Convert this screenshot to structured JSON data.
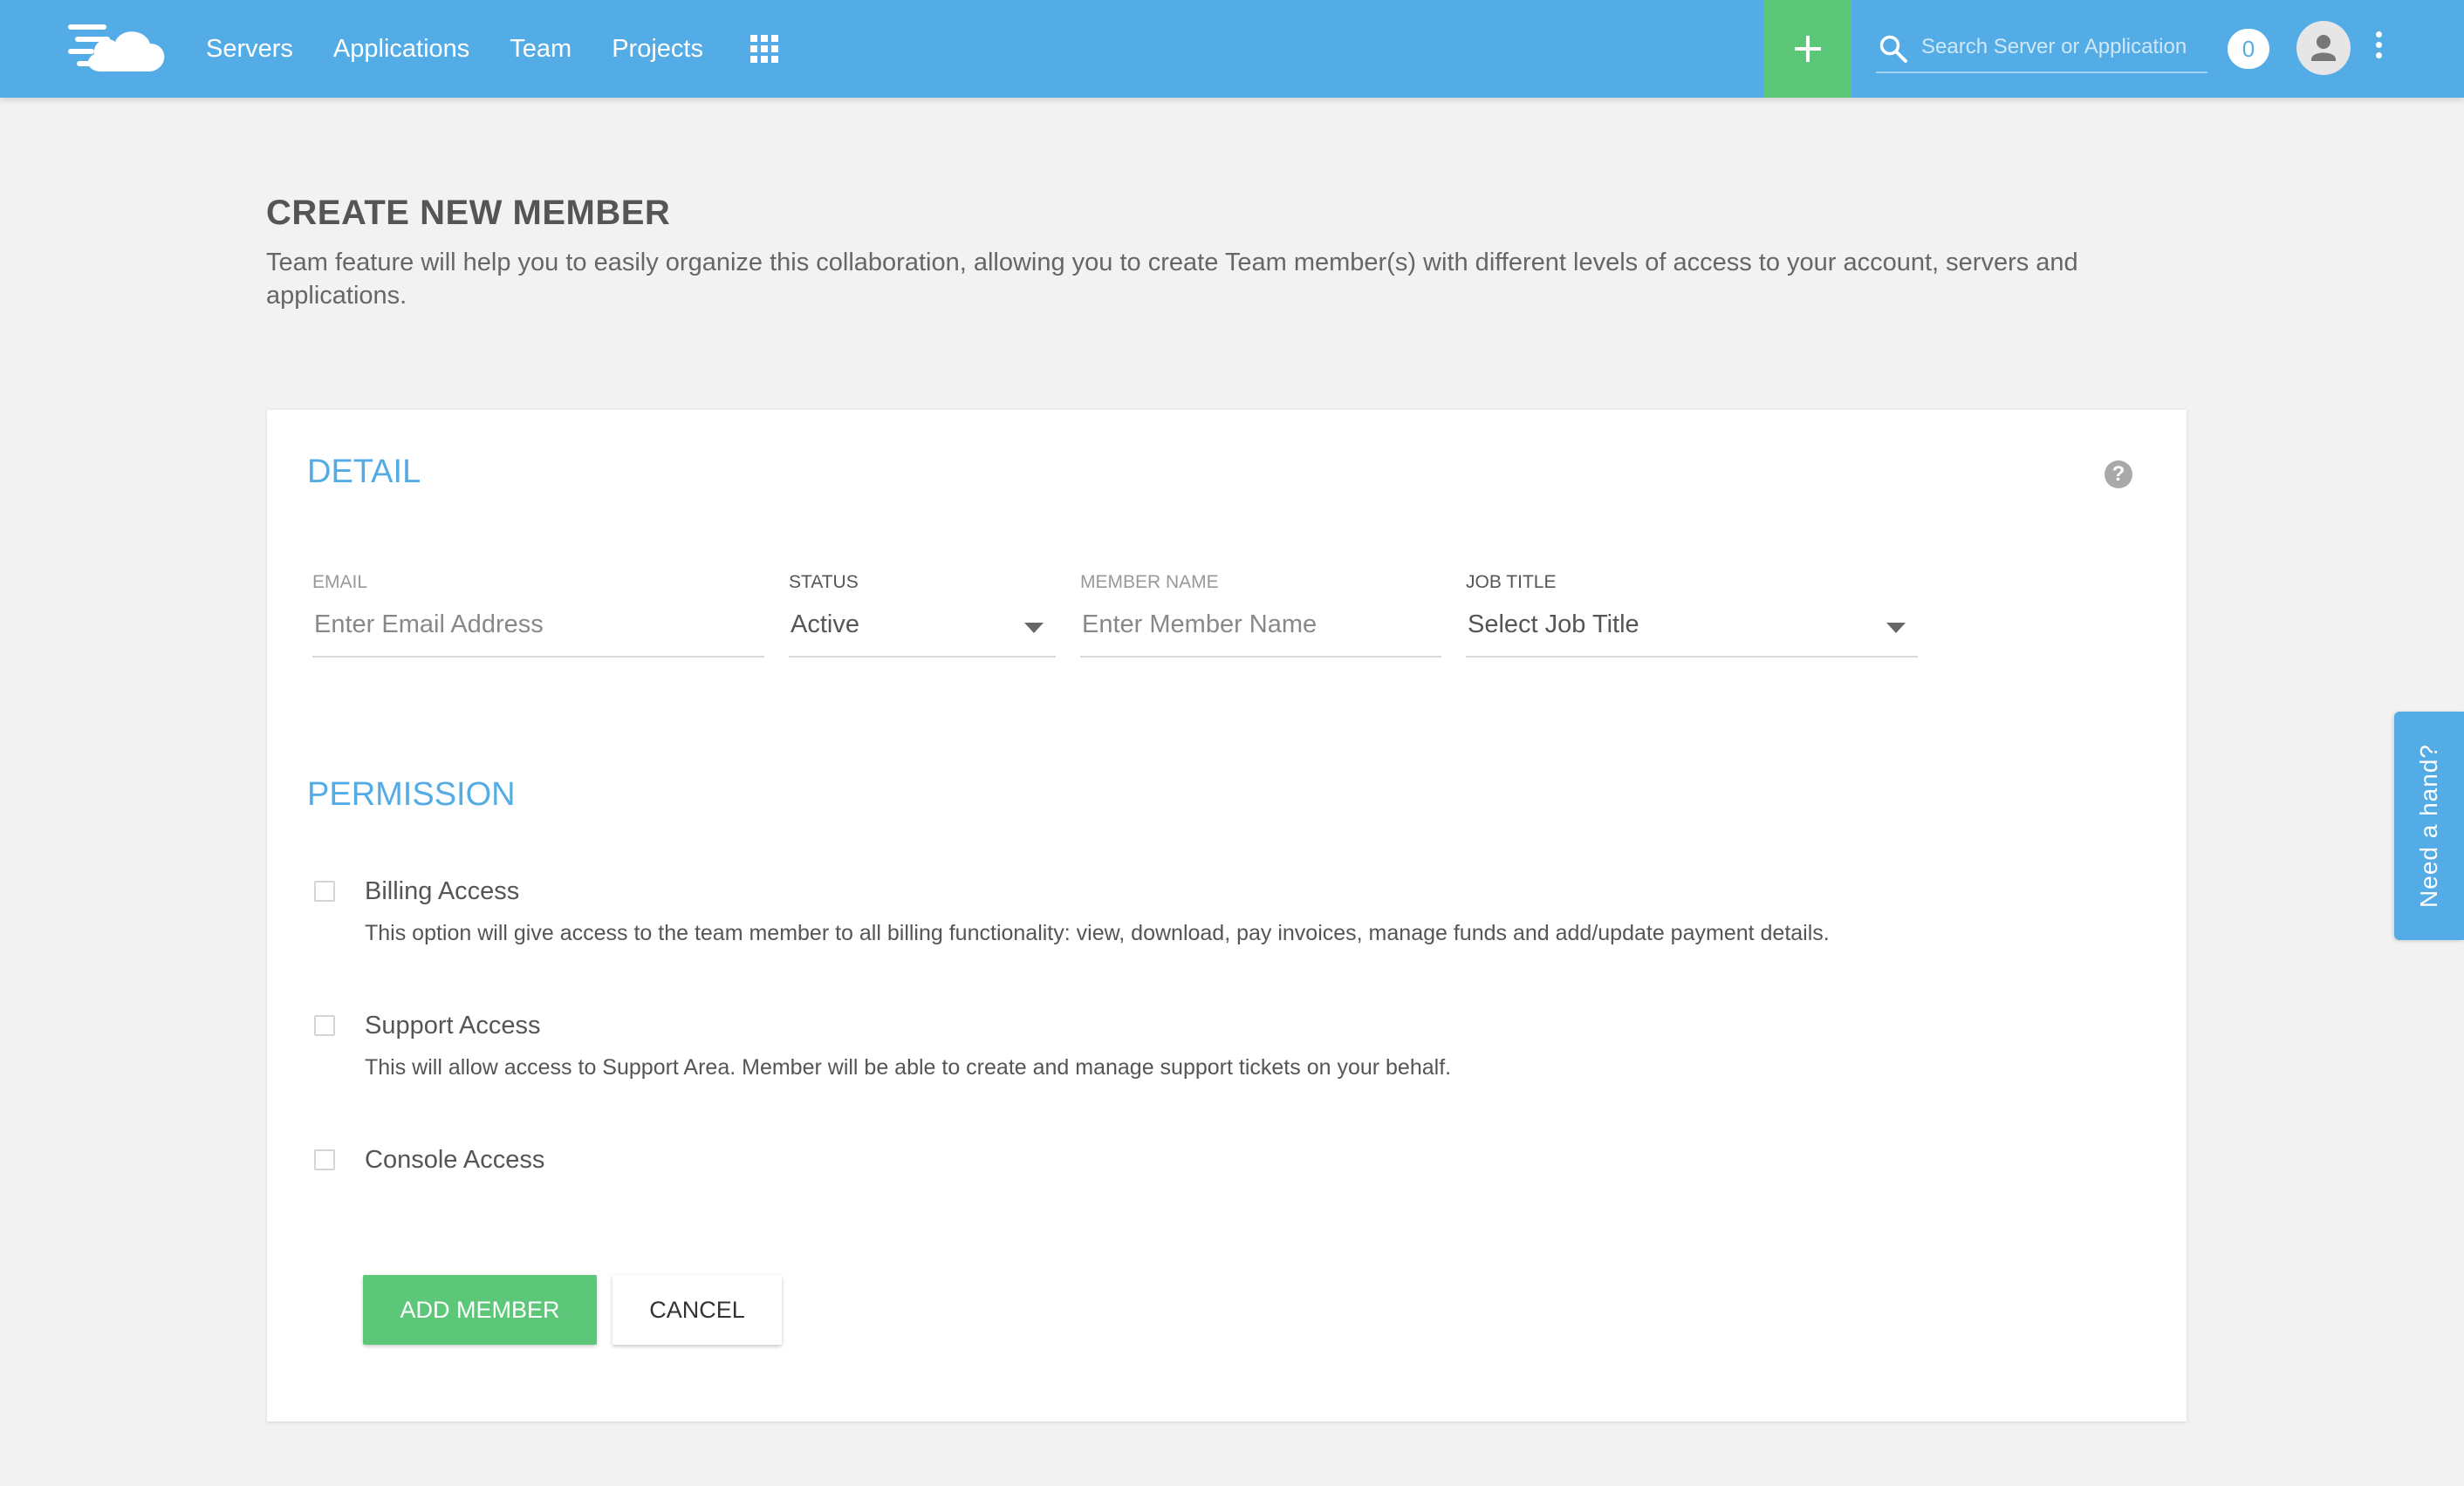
{
  "colors": {
    "topbar": "#54ace6",
    "accent_green": "#5dc779",
    "section_title": "#54ace6",
    "page_background": "#f2f2f2"
  },
  "header": {
    "logo_icon": "cloud-logo-icon",
    "nav": [
      "Servers",
      "Applications",
      "Team",
      "Projects"
    ],
    "apps_icon": "grid-icon",
    "add_icon": "plus-icon",
    "search": {
      "icon": "search-icon",
      "placeholder": "Search Server or Application",
      "value": ""
    },
    "notifications_count": "0",
    "avatar_icon": "user-icon",
    "menu_icon": "more-vertical-icon"
  },
  "page": {
    "title": "CREATE NEW MEMBER",
    "description": "Team feature will help you to easily organize this collaboration, allowing you to create Team member(s) with different levels of access to your account, servers and applications."
  },
  "detail": {
    "title": "DETAIL",
    "help_icon": "question-circle-icon",
    "help_glyph": "?",
    "email": {
      "label": "EMAIL",
      "placeholder": "Enter Email Address",
      "value": ""
    },
    "status": {
      "label": "STATUS",
      "value": "Active"
    },
    "member_name": {
      "label": "MEMBER NAME",
      "placeholder": "Enter Member Name",
      "value": ""
    },
    "job_title": {
      "label": "JOB TITLE",
      "value": "Select Job Title"
    }
  },
  "permission": {
    "title": "PERMISSION",
    "items": [
      {
        "title": "Billing Access",
        "description": "This option will give access to the team member to all billing functionality: view, download, pay invoices, manage funds and add/update payment details.",
        "checked": false
      },
      {
        "title": "Support Access",
        "description": "This will allow access to Support Area. Member will be able to create and manage support tickets on your behalf.",
        "checked": false
      },
      {
        "title": "Console Access",
        "description": "",
        "checked": false
      }
    ]
  },
  "actions": {
    "add": "ADD MEMBER",
    "cancel": "CANCEL"
  },
  "help_tab": "Need a hand?"
}
